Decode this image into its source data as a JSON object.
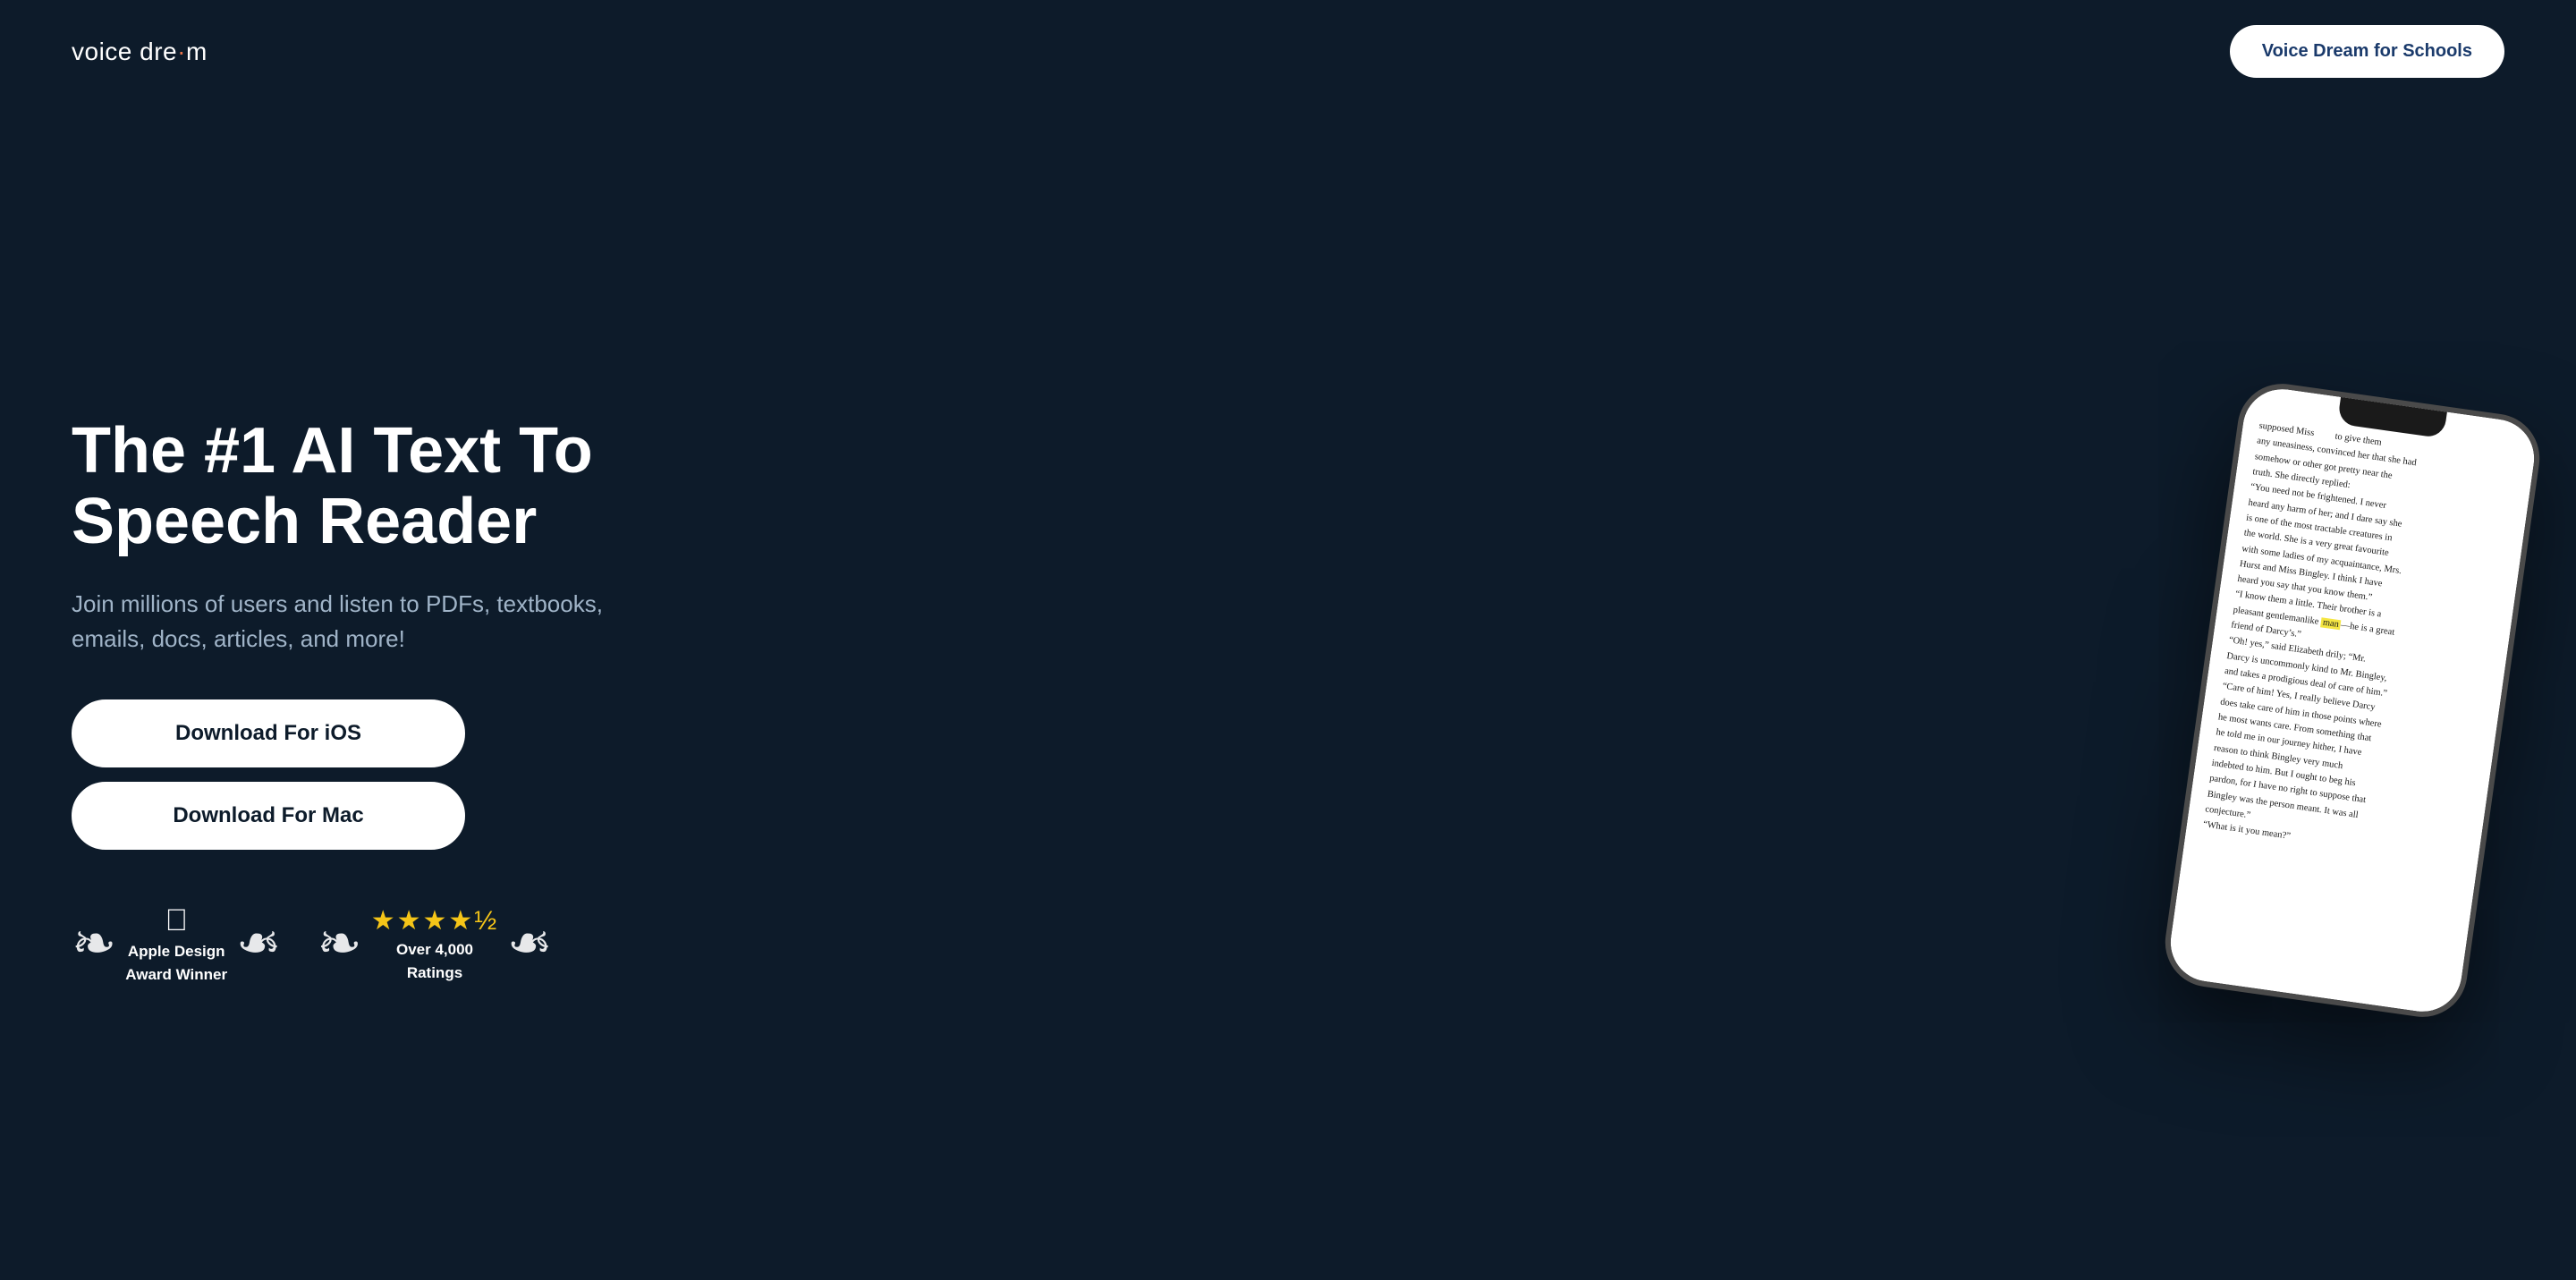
{
  "header": {
    "logo": "voice dream",
    "logo_dot": "·",
    "schools_button_label": "Voice Dream for Schools"
  },
  "hero": {
    "title": "The #1 AI Text To Speech Reader",
    "subtitle": "Join millions of users and listen to PDFs, textbooks, emails, docs, articles, and more!",
    "buttons": [
      {
        "id": "ios",
        "label": "Download For iOS"
      },
      {
        "id": "mac",
        "label": "Download For Mac"
      }
    ],
    "badges": [
      {
        "id": "apple-design",
        "icon": "apple",
        "line1": "Apple Design",
        "line2": "Award Winner"
      },
      {
        "id": "ratings",
        "stars": "★★★★½",
        "line1": "Over 4,000",
        "line2": "Ratings"
      }
    ]
  },
  "phone": {
    "text_lines": [
      "supposed Miss         to give them",
      "any uneasiness, convinced her that she had",
      "somehow or other got pretty near the",
      "truth. She directly replied:",
      "\"You need not be frightened. I never",
      "heard any harm of her; and I dare say she",
      "is one of the most tractable creatures in",
      "the world. She is a very great favourite",
      "with some ladies of my acquaintance, Mrs.",
      "Hurst and Miss Bingley. I think I have",
      "heard you say that you know them.\"",
      "\"I know them a little. Their brother is a",
      "pleasant gentlemanlike man—he is a great",
      "friend of Darcy's.\"",
      "\"Oh! yes,\" said Elizabeth drily; \"Mr.",
      "Darcy is uncommonly kind to Mr. Bingley,",
      "and takes a prodigious deal of care of him.\"",
      "\"Care of him! Yes, I really believe Darcy",
      "does take care of him in those points where",
      "he most wants care. From something that",
      "he told me in our journey hither, I have",
      "reason to think Bingley very much",
      "indebted to him. But I ought to beg his",
      "pardon, for I have no right to suppose that",
      "Bingley was the person meant. It was all",
      "conjecture.\"",
      "\"What is it you mean?\""
    ],
    "highlight_word": "man"
  },
  "colors": {
    "bg": "#0d1b2a",
    "accent": "#e8734a",
    "button_text": "#0d1b2a",
    "schools_btn_text": "#1a3a6b",
    "star_color": "#f5c518"
  }
}
